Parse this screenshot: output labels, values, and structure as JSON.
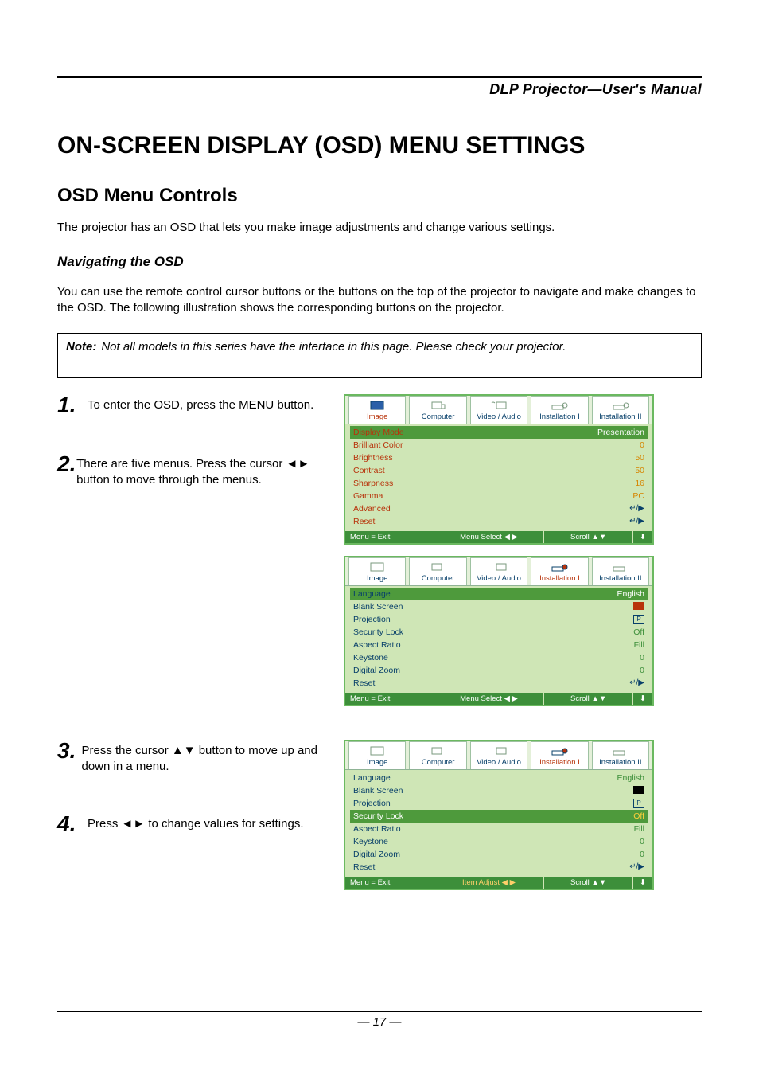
{
  "header": {
    "title": "DLP Projector—User's Manual"
  },
  "section": {
    "h1": "ON-SCREEN DISPLAY (OSD) MENU SETTINGS",
    "h2": "OSD Menu Controls"
  },
  "intro": "The projector has an OSD that lets you make image adjustments and change various settings.",
  "navHeading": "Navigating the OSD",
  "navBody": "You can use the remote control cursor buttons or the buttons on the top of the projector to navigate and make changes to the OSD. The following illustration shows the corresponding buttons on the projector.",
  "note": {
    "label": "Note:",
    "text": "Not all models in this series have the interface in this page. Please check your projector."
  },
  "steps": [
    {
      "num": "1.",
      "text": "To enter the OSD, press the MENU button."
    },
    {
      "num": "2.",
      "text": "There are five menus. Press the cursor ◄► button to move through the menus."
    },
    {
      "num": "3.",
      "text": "Press the cursor ▲▼ button to move up and down in a menu."
    },
    {
      "num": "4.",
      "text": "Press ◄► to change values for settings."
    }
  ],
  "tabs": [
    "Image",
    "Computer",
    "Video / Audio",
    "Installation I",
    "Installation II"
  ],
  "osdImage": {
    "activeTab": 0,
    "rows": [
      {
        "label": "Display Mode",
        "value": "Presentation",
        "hl": true
      },
      {
        "label": "Brilliant Color",
        "value": "0"
      },
      {
        "label": "Brightness",
        "value": "50"
      },
      {
        "label": "Contrast",
        "value": "50"
      },
      {
        "label": "Sharpness",
        "value": "16"
      },
      {
        "label": "Gamma",
        "value": "PC"
      },
      {
        "label": "Advanced",
        "value": "↵/▶"
      },
      {
        "label": "Reset",
        "value": "↵/▶"
      }
    ],
    "footer": {
      "a": "Menu = Exit",
      "b": "Menu Select ◀ ▶",
      "c": "Scroll ▲▼"
    }
  },
  "osdInstall": {
    "activeTab": 3,
    "rows": [
      {
        "label": "Language",
        "value": "English",
        "hl": true
      },
      {
        "label": "Blank Screen",
        "value": "swatch"
      },
      {
        "label": "Projection",
        "value": "P"
      },
      {
        "label": "Security Lock",
        "value": "Off"
      },
      {
        "label": "Aspect Ratio",
        "value": "Fill"
      },
      {
        "label": "Keystone",
        "value": "0"
      },
      {
        "label": "Digital Zoom",
        "value": "0"
      },
      {
        "label": "Reset",
        "value": "↵/▶"
      }
    ],
    "footer": {
      "a": "Menu = Exit",
      "b": "Menu Select ◀ ▶",
      "c": "Scroll ▲▼"
    }
  },
  "osdInstallSel": {
    "activeTab": 3,
    "rows": [
      {
        "label": "Language",
        "value": "English"
      },
      {
        "label": "Blank Screen",
        "value": "swatch-black"
      },
      {
        "label": "Projection",
        "value": "P"
      },
      {
        "label": "Security Lock",
        "value": "Off",
        "hl": true
      },
      {
        "label": "Aspect Ratio",
        "value": "Fill"
      },
      {
        "label": "Keystone",
        "value": "0"
      },
      {
        "label": "Digital Zoom",
        "value": "0"
      },
      {
        "label": "Reset",
        "value": "↵/▶"
      }
    ],
    "footer": {
      "a": "Menu = Exit",
      "b": "Item Adjust ◀ ▶",
      "bOrange": true,
      "c": "Scroll ▲▼"
    }
  },
  "footerPage": "— 17 —"
}
